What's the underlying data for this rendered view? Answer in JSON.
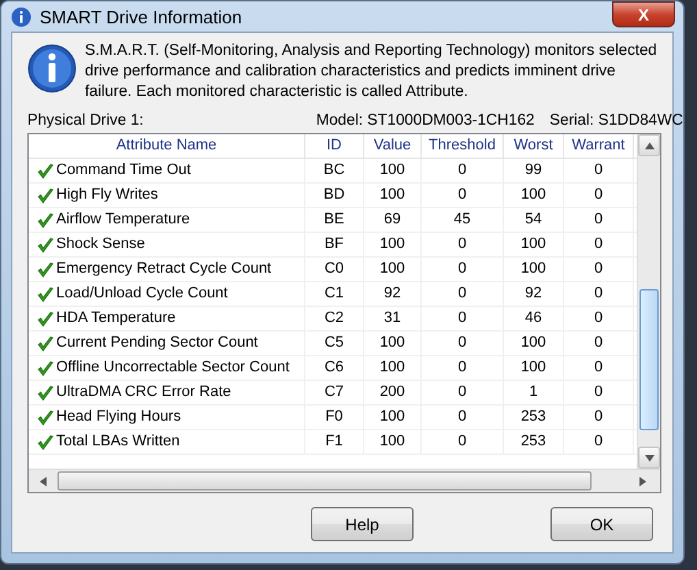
{
  "window": {
    "title": "SMART Drive Information",
    "close": "X"
  },
  "description": "S.M.A.R.T. (Self-Monitoring, Analysis and Reporting Technology) monitors selected drive performance and calibration characteristics and predicts imminent drive failure. Each monitored characteristic is called Attribute.",
  "drive": {
    "label": "Physical Drive 1:",
    "model": "Model: ST1000DM003-1CH162",
    "serial": "Serial: S1DD84WC"
  },
  "table": {
    "columns": [
      "Attribute Name",
      "ID",
      "Value",
      "Threshold",
      "Worst",
      "Warrant"
    ],
    "rows": [
      {
        "cells": [
          "Command Time Out",
          "BC",
          "100",
          "0",
          "99",
          "0"
        ]
      },
      {
        "cells": [
          "High Fly Writes",
          "BD",
          "100",
          "0",
          "100",
          "0"
        ]
      },
      {
        "cells": [
          "Airflow Temperature",
          "BE",
          "69",
          "45",
          "54",
          "0"
        ]
      },
      {
        "cells": [
          "Shock Sense",
          "BF",
          "100",
          "0",
          "100",
          "0"
        ]
      },
      {
        "cells": [
          "Emergency Retract Cycle Count",
          "C0",
          "100",
          "0",
          "100",
          "0"
        ]
      },
      {
        "cells": [
          "Load/Unload Cycle Count",
          "C1",
          "92",
          "0",
          "92",
          "0"
        ]
      },
      {
        "cells": [
          "HDA Temperature",
          "C2",
          "31",
          "0",
          "46",
          "0"
        ]
      },
      {
        "cells": [
          "Current Pending Sector Count",
          "C5",
          "100",
          "0",
          "100",
          "0"
        ]
      },
      {
        "cells": [
          "Offline Uncorrectable Sector Count",
          "C6",
          "100",
          "0",
          "100",
          "0"
        ]
      },
      {
        "cells": [
          "UltraDMA CRC Error Rate",
          "C7",
          "200",
          "0",
          "1",
          "0"
        ]
      },
      {
        "cells": [
          "Head Flying Hours",
          "F0",
          "100",
          "0",
          "253",
          "0"
        ]
      },
      {
        "cells": [
          "Total LBAs Written",
          "F1",
          "100",
          "0",
          "253",
          "0"
        ]
      }
    ]
  },
  "buttons": [
    {
      "label": "Help"
    },
    {
      "label": "OK"
    }
  ]
}
